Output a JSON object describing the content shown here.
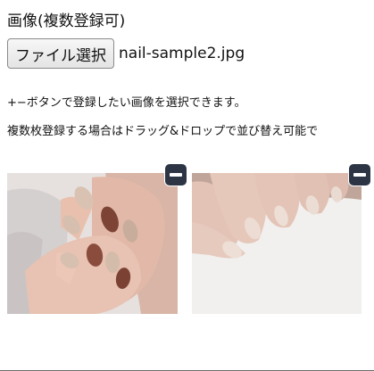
{
  "upload": {
    "label": "画像(複数登録可)",
    "button_label": "ファイル選択",
    "selected_file": "nail-sample2.jpg"
  },
  "hints": [
    "+−ボタンで登録したい画像を選択できます。",
    "複数枚登録する場合はドラッグ&ドロップで並び替え可能で"
  ],
  "thumbnails": [
    {
      "icon": "minus-icon"
    },
    {
      "icon": "minus-icon"
    }
  ],
  "colors": {
    "remove_button": "#2d3545",
    "nail_brown": "#8b4b3c",
    "nail_beige": "#d8c3b4"
  }
}
